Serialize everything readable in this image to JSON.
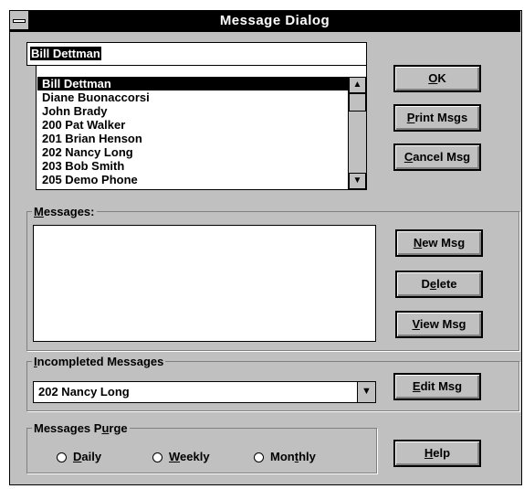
{
  "window": {
    "title": "Message Dialog"
  },
  "recipient": {
    "value": "Bill Dettman",
    "list": [
      "Bill Dettman",
      "Diane Buonaccorsi",
      "John Brady",
      "200 Pat Walker",
      "201 Brian Henson",
      "202 Nancy Long",
      "203 Bob Smith",
      "205 Demo Phone"
    ],
    "selected_index": 0
  },
  "buttons": {
    "ok": {
      "hot": "O",
      "rest": "K"
    },
    "print": {
      "hot": "P",
      "rest": "rint Msgs"
    },
    "cancel": {
      "hot": "C",
      "rest": "ancel Msg"
    },
    "new": {
      "hot": "N",
      "rest": "ew Msg"
    },
    "delete": {
      "pre": "D",
      "hot": "e",
      "rest": "lete"
    },
    "view": {
      "hot": "V",
      "rest": "iew Msg"
    },
    "edit": {
      "hot": "E",
      "rest": "dit Msg"
    },
    "help": {
      "hot": "H",
      "rest": "elp"
    }
  },
  "messages": {
    "hot": "M",
    "rest": "essages:"
  },
  "incompleted": {
    "hot": "I",
    "rest": "ncompleted Messages",
    "selected": "202 Nancy Long"
  },
  "purge": {
    "pre": "Messages P",
    "hot": "u",
    "rest": "rge",
    "options": {
      "daily": {
        "hot": "D",
        "rest": "aily"
      },
      "weekly": {
        "hot": "W",
        "rest": "eekly"
      },
      "monthly": {
        "pre": "Mon",
        "hot": "t",
        "rest": "hly"
      }
    }
  },
  "icons": {
    "system_menu": "system-menu-icon",
    "scroll_up": "▲",
    "scroll_down": "▼",
    "dropdown": "▼"
  }
}
